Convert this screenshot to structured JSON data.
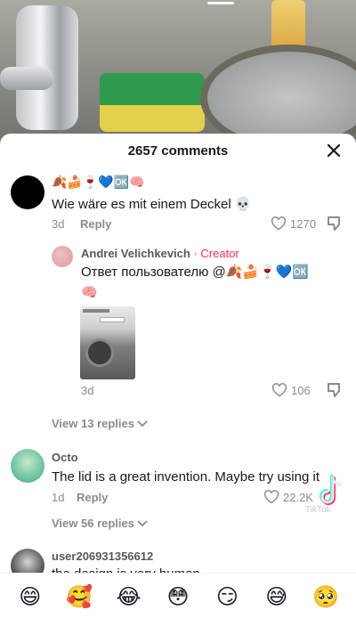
{
  "video": {
    "description_icon": "kitchen-sink-video-frame"
  },
  "sheet": {
    "title": "2657 comments",
    "close_icon": "close-icon"
  },
  "comments": [
    {
      "name_emojis": "🍂🍰🍷💙🆗🧠",
      "text": "Wie wäre es mit einem Deckel 💀",
      "date": "3d",
      "reply_label": "Reply",
      "likes": "1270"
    },
    {
      "name": "Andrei Velichkevich",
      "creator_label": "· Creator",
      "text": "Ответ пользователю @🍂🍰🍷💙🆗",
      "text_line2": "🧠",
      "date": "3d",
      "likes": "106"
    },
    {
      "view_replies": "View 13 replies"
    },
    {
      "name": "Octo",
      "text": "The lid is a great invention. Maybe try using it",
      "date": "1d",
      "reply_label": "Reply",
      "likes": "22.2K"
    },
    {
      "view_replies": "View 56 replies"
    },
    {
      "name": "user206931356612",
      "text": "the design is very human"
    }
  ],
  "emoji_bar": [
    "😄",
    "🥰",
    "😂",
    "😳",
    "😏",
    "😅",
    "🥺"
  ],
  "watermark": "TikTok",
  "colors": {
    "accent": "#fe2c55",
    "text": "#161823",
    "muted": "#8a8b91"
  }
}
